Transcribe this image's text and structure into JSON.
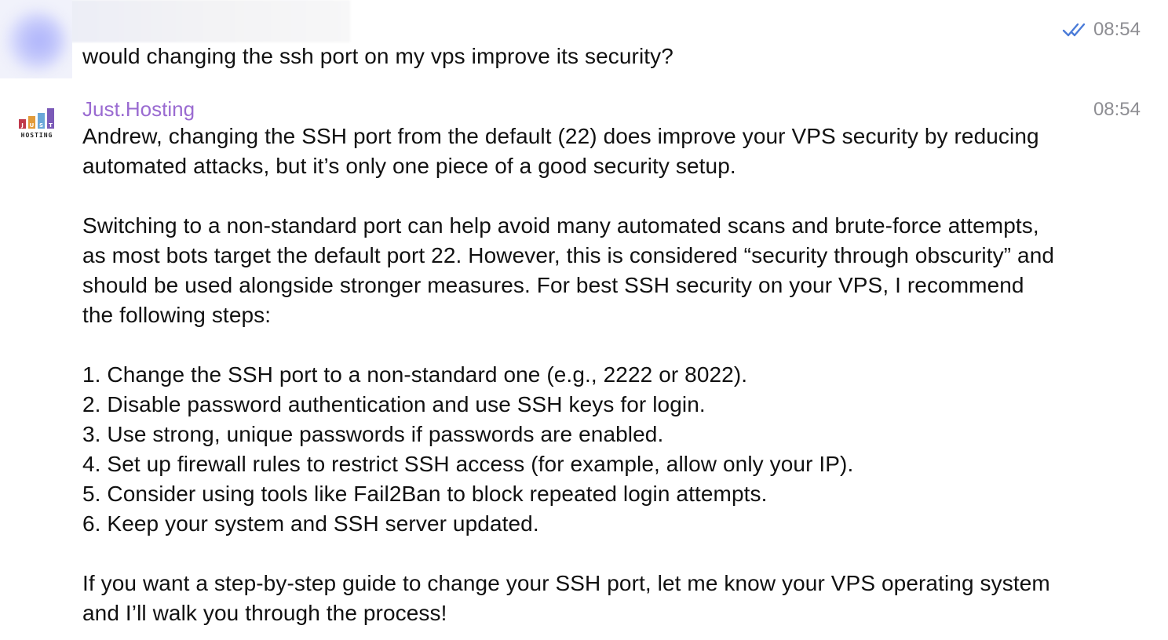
{
  "user_message": {
    "text": "would changing the ssh port on my vps improve its security?",
    "time": "08:54",
    "status_icon": "double-check-icon"
  },
  "bot_message": {
    "sender": "Just.Hosting",
    "time": "08:54",
    "avatar": {
      "logo_letters": [
        "J",
        "U",
        "S",
        "T"
      ],
      "logo_subtext": "HOSTING",
      "bar_colors": [
        "#c0394b",
        "#e29b3a",
        "#6aa7d8",
        "#7b5ab8"
      ]
    },
    "text": "Andrew, changing the SSH port from the default (22) does improve your VPS security by reducing automated attacks, but it’s only one piece of a good security setup.\n\nSwitching to a non-standard port can help avoid many automated scans and brute-force attempts, as most bots target the default port 22. However, this is considered “security through obscurity” and should be used alongside stronger measures. For best SSH security on your VPS, I recommend the following steps:\n\n1. Change the SSH port to a non-standard one (e.g., 2222 or 8022).\n2. Disable password authentication and use SSH keys for login.\n3. Use strong, unique passwords if passwords are enabled.\n4. Set up firewall rules to restrict SSH access (for example, allow only your IP).\n5. Consider using tools like Fail2Ban to block repeated login attempts.\n6. Keep your system and SSH server updated.\n\nIf you want a step-by-step guide to change your SSH port, let me know your VPS operating system and I’ll walk you through the process!"
  },
  "colors": {
    "sender_name": "#9a6bd1",
    "timestamp": "#8e8e93",
    "read_check": "#4a7bd8"
  }
}
